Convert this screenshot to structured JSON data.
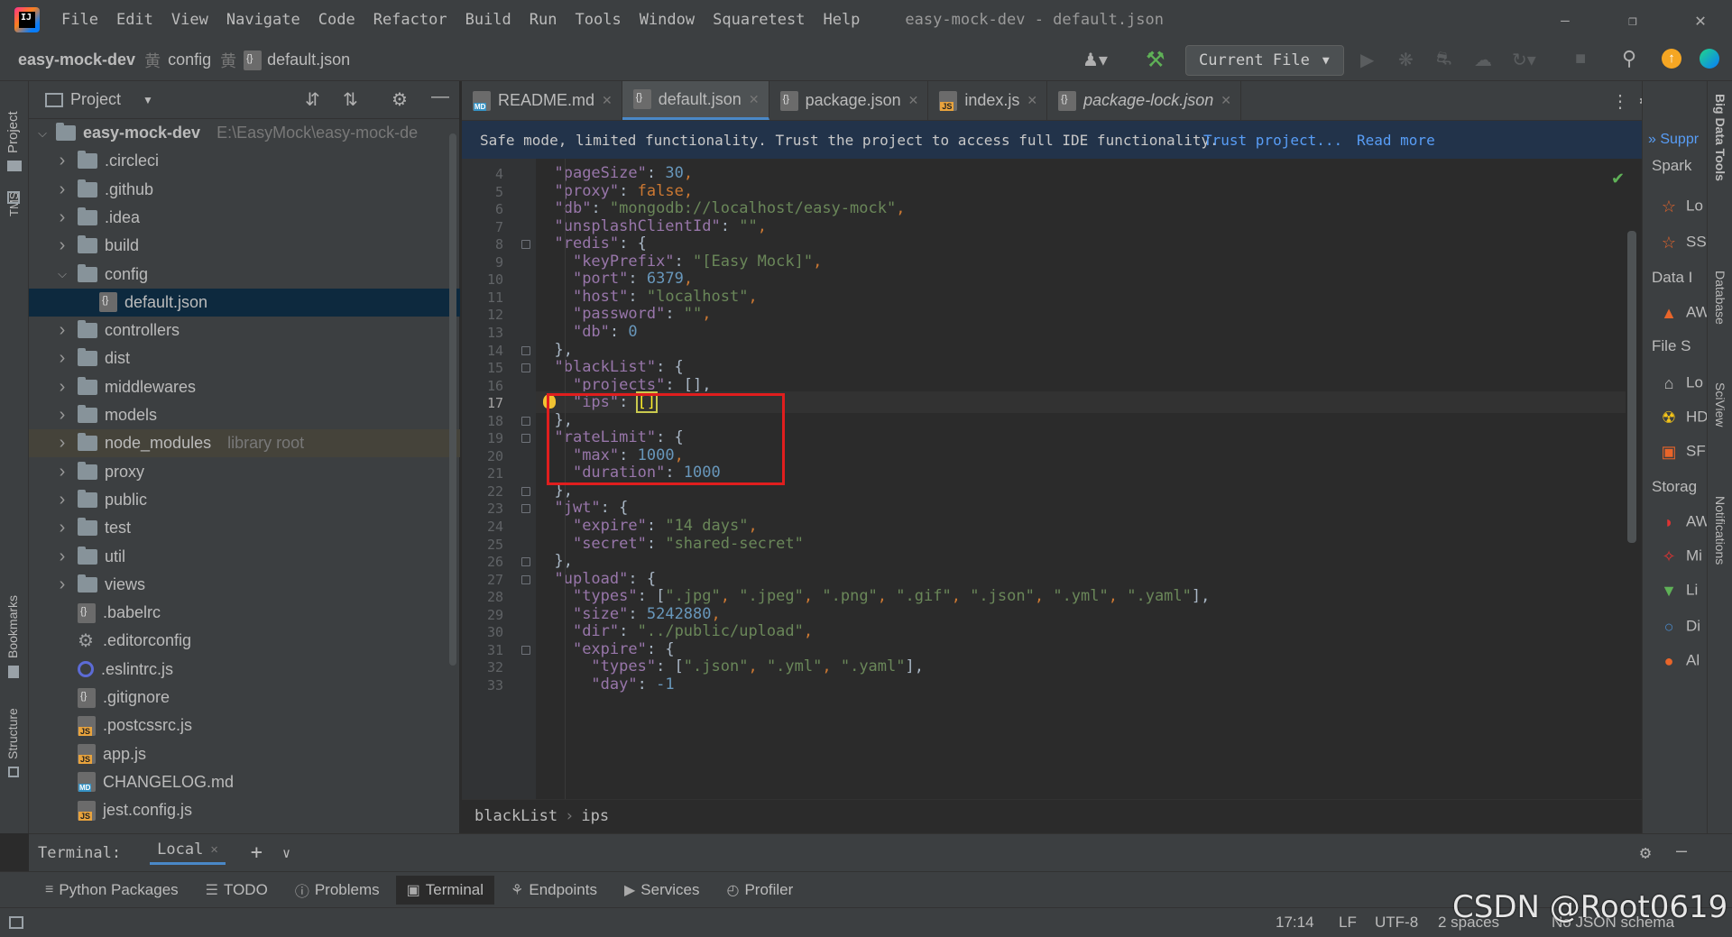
{
  "menubar": {
    "items": [
      "File",
      "Edit",
      "View",
      "Navigate",
      "Code",
      "Refactor",
      "Build",
      "Run",
      "Tools",
      "Window",
      "Squaretest",
      "Help"
    ],
    "window_title": "easy-mock-dev - default.json"
  },
  "navbar": {
    "crumbs": [
      "easy-mock-dev",
      "config",
      "default.json"
    ],
    "run_config": "Current File"
  },
  "left_stripe": {
    "project": "Project",
    "tms": "TMS",
    "bookmarks": "Bookmarks",
    "structure": "Structure"
  },
  "project_panel": {
    "title": "Project",
    "root": {
      "name": "easy-mock-dev",
      "path": "E:\\EasyMock\\easy-mock-de"
    },
    "items": [
      {
        "label": "circleci",
        "display": ".circleci",
        "kind": "folder",
        "expanded": false
      },
      {
        "label": "github",
        "display": ".github",
        "kind": "folder",
        "expanded": false
      },
      {
        "label": "idea",
        "display": ".idea",
        "kind": "folder",
        "expanded": false
      },
      {
        "label": "build",
        "display": "build",
        "kind": "folder",
        "expanded": false
      },
      {
        "label": "config",
        "display": "config",
        "kind": "folder",
        "expanded": true
      },
      {
        "label": "default-json",
        "display": "default.json",
        "kind": "json",
        "selected": true
      },
      {
        "label": "controllers",
        "display": "controllers",
        "kind": "folder"
      },
      {
        "label": "dist",
        "display": "dist",
        "kind": "folder"
      },
      {
        "label": "middlewares",
        "display": "middlewares",
        "kind": "folder"
      },
      {
        "label": "models",
        "display": "models",
        "kind": "folder"
      },
      {
        "label": "node-modules",
        "display": "node_modules",
        "kind": "folder",
        "extra": "library root"
      },
      {
        "label": "proxy",
        "display": "proxy",
        "kind": "folder"
      },
      {
        "label": "public",
        "display": "public",
        "kind": "folder"
      },
      {
        "label": "test",
        "display": "test",
        "kind": "folder"
      },
      {
        "label": "util",
        "display": "util",
        "kind": "folder"
      },
      {
        "label": "views",
        "display": "views",
        "kind": "folder"
      },
      {
        "label": "babelrc",
        "display": ".babelrc",
        "kind": "json"
      },
      {
        "label": "editorconfig",
        "display": ".editorconfig",
        "kind": "gear"
      },
      {
        "label": "eslintrc",
        "display": ".eslintrc.js",
        "kind": "ring"
      },
      {
        "label": "gitignore",
        "display": ".gitignore",
        "kind": "json"
      },
      {
        "label": "postcssrc",
        "display": ".postcssrc.js",
        "kind": "js"
      },
      {
        "label": "app-js",
        "display": "app.js",
        "kind": "js"
      },
      {
        "label": "changelog",
        "display": "CHANGELOG.md",
        "kind": "md"
      },
      {
        "label": "jest-config",
        "display": "jest.config.js",
        "kind": "js"
      }
    ]
  },
  "tabs": [
    {
      "label": "README.md",
      "icon": "md",
      "active": false,
      "italic": false
    },
    {
      "label": "default.json",
      "icon": "json",
      "active": true,
      "italic": false
    },
    {
      "label": "package.json",
      "icon": "json",
      "active": false,
      "italic": false
    },
    {
      "label": "index.js",
      "icon": "js",
      "active": false,
      "italic": false
    },
    {
      "label": "package-lock.json",
      "icon": "json",
      "active": false,
      "italic": true
    }
  ],
  "banner": {
    "message": "Safe mode, limited functionality. Trust the project to access full IDE functionality.",
    "trust_link": "Trust project...",
    "read_more": "Read more"
  },
  "editor": {
    "current_line": 17,
    "lines": [
      {
        "n": 4,
        "tokens": [
          [
            "p",
            "  "
          ],
          [
            "k",
            "\"pageSize\""
          ],
          [
            "p",
            ": "
          ],
          [
            "n",
            "30"
          ],
          [
            "b",
            ","
          ]
        ]
      },
      {
        "n": 5,
        "tokens": [
          [
            "p",
            "  "
          ],
          [
            "k",
            "\"proxy\""
          ],
          [
            "p",
            ": "
          ],
          [
            "b",
            "false"
          ],
          [
            "b",
            ","
          ]
        ]
      },
      {
        "n": 6,
        "tokens": [
          [
            "p",
            "  "
          ],
          [
            "k",
            "\"db\""
          ],
          [
            "p",
            ": "
          ],
          [
            "s",
            "\"mongodb://localhost/easy-mock\""
          ],
          [
            "b",
            ","
          ]
        ]
      },
      {
        "n": 7,
        "tokens": [
          [
            "p",
            "  "
          ],
          [
            "k",
            "\"unsplashClientId\""
          ],
          [
            "p",
            ": "
          ],
          [
            "s",
            "\"\""
          ],
          [
            "b",
            ","
          ]
        ]
      },
      {
        "n": 8,
        "tokens": [
          [
            "p",
            "  "
          ],
          [
            "k",
            "\"redis\""
          ],
          [
            "p",
            ": {"
          ]
        ]
      },
      {
        "n": 9,
        "tokens": [
          [
            "p",
            "    "
          ],
          [
            "k",
            "\"keyPrefix\""
          ],
          [
            "p",
            ": "
          ],
          [
            "s",
            "\"[Easy Mock]\""
          ],
          [
            "b",
            ","
          ]
        ]
      },
      {
        "n": 10,
        "tokens": [
          [
            "p",
            "    "
          ],
          [
            "k",
            "\"port\""
          ],
          [
            "p",
            ": "
          ],
          [
            "n",
            "6379"
          ],
          [
            "b",
            ","
          ]
        ]
      },
      {
        "n": 11,
        "tokens": [
          [
            "p",
            "    "
          ],
          [
            "k",
            "\"host\""
          ],
          [
            "p",
            ": "
          ],
          [
            "s",
            "\"localhost\""
          ],
          [
            "b",
            ","
          ]
        ]
      },
      {
        "n": 12,
        "tokens": [
          [
            "p",
            "    "
          ],
          [
            "k",
            "\"password\""
          ],
          [
            "p",
            ": "
          ],
          [
            "s",
            "\"\""
          ],
          [
            "b",
            ","
          ]
        ]
      },
      {
        "n": 13,
        "tokens": [
          [
            "p",
            "    "
          ],
          [
            "k",
            "\"db\""
          ],
          [
            "p",
            ": "
          ],
          [
            "n",
            "0"
          ]
        ]
      },
      {
        "n": 14,
        "tokens": [
          [
            "p",
            "  },"
          ]
        ]
      },
      {
        "n": 15,
        "tokens": [
          [
            "p",
            "  "
          ],
          [
            "k",
            "\"blackList\""
          ],
          [
            "p",
            ": {"
          ]
        ]
      },
      {
        "n": 16,
        "tokens": [
          [
            "p",
            "    "
          ],
          [
            "k",
            "\"projects\""
          ],
          [
            "p",
            ": [],"
          ]
        ]
      },
      {
        "n": 17,
        "tokens": [
          [
            "p",
            "    "
          ],
          [
            "k",
            "\"ips\""
          ],
          [
            "p",
            ": "
          ],
          [
            "m",
            "[]"
          ]
        ]
      },
      {
        "n": 18,
        "tokens": [
          [
            "p",
            "  },"
          ]
        ]
      },
      {
        "n": 19,
        "tokens": [
          [
            "p",
            "  "
          ],
          [
            "k",
            "\"rateLimit\""
          ],
          [
            "p",
            ": {"
          ]
        ]
      },
      {
        "n": 20,
        "tokens": [
          [
            "p",
            "    "
          ],
          [
            "k",
            "\"max\""
          ],
          [
            "p",
            ": "
          ],
          [
            "n",
            "1000"
          ],
          [
            "b",
            ","
          ]
        ]
      },
      {
        "n": 21,
        "tokens": [
          [
            "p",
            "    "
          ],
          [
            "k",
            "\"duration\""
          ],
          [
            "p",
            ": "
          ],
          [
            "n",
            "1000"
          ]
        ]
      },
      {
        "n": 22,
        "tokens": [
          [
            "p",
            "  },"
          ]
        ]
      },
      {
        "n": 23,
        "tokens": [
          [
            "p",
            "  "
          ],
          [
            "k",
            "\"jwt\""
          ],
          [
            "p",
            ": {"
          ]
        ]
      },
      {
        "n": 24,
        "tokens": [
          [
            "p",
            "    "
          ],
          [
            "k",
            "\"expire\""
          ],
          [
            "p",
            ": "
          ],
          [
            "s",
            "\"14 days\""
          ],
          [
            "b",
            ","
          ]
        ]
      },
      {
        "n": 25,
        "tokens": [
          [
            "p",
            "    "
          ],
          [
            "k",
            "\"secret\""
          ],
          [
            "p",
            ": "
          ],
          [
            "s",
            "\"shared-secret\""
          ]
        ]
      },
      {
        "n": 26,
        "tokens": [
          [
            "p",
            "  },"
          ]
        ]
      },
      {
        "n": 27,
        "tokens": [
          [
            "p",
            "  "
          ],
          [
            "k",
            "\"upload\""
          ],
          [
            "p",
            ": {"
          ]
        ]
      },
      {
        "n": 28,
        "tokens": [
          [
            "p",
            "    "
          ],
          [
            "k",
            "\"types\""
          ],
          [
            "p",
            ": ["
          ],
          [
            "s",
            "\".jpg\""
          ],
          [
            "b",
            ", "
          ],
          [
            "s",
            "\".jpeg\""
          ],
          [
            "b",
            ", "
          ],
          [
            "s",
            "\".png\""
          ],
          [
            "b",
            ", "
          ],
          [
            "s",
            "\".gif\""
          ],
          [
            "b",
            ", "
          ],
          [
            "s",
            "\".json\""
          ],
          [
            "b",
            ", "
          ],
          [
            "s",
            "\".yml\""
          ],
          [
            "b",
            ", "
          ],
          [
            "s",
            "\".yaml\""
          ],
          [
            "p",
            "],"
          ]
        ]
      },
      {
        "n": 29,
        "tokens": [
          [
            "p",
            "    "
          ],
          [
            "k",
            "\"size\""
          ],
          [
            "p",
            ": "
          ],
          [
            "n",
            "5242880"
          ],
          [
            "b",
            ","
          ]
        ]
      },
      {
        "n": 30,
        "tokens": [
          [
            "p",
            "    "
          ],
          [
            "k",
            "\"dir\""
          ],
          [
            "p",
            ": "
          ],
          [
            "s",
            "\"../public/upload\""
          ],
          [
            "b",
            ","
          ]
        ]
      },
      {
        "n": 31,
        "tokens": [
          [
            "p",
            "    "
          ],
          [
            "k",
            "\"expire\""
          ],
          [
            "p",
            ": {"
          ]
        ]
      },
      {
        "n": 32,
        "tokens": [
          [
            "p",
            "      "
          ],
          [
            "k",
            "\"types\""
          ],
          [
            "p",
            ": ["
          ],
          [
            "s",
            "\".json\""
          ],
          [
            "b",
            ", "
          ],
          [
            "s",
            "\".yml\""
          ],
          [
            "b",
            ", "
          ],
          [
            "s",
            "\".yaml\""
          ],
          [
            "p",
            "],"
          ]
        ]
      },
      {
        "n": 33,
        "tokens": [
          [
            "p",
            "      "
          ],
          [
            "k",
            "\"day\""
          ],
          [
            "p",
            ": "
          ],
          [
            "n",
            "-1"
          ]
        ]
      }
    ]
  },
  "editor_breadcrumb": [
    "blackList",
    "ips"
  ],
  "right_panel": {
    "suppress": "» Suppr",
    "items": [
      "Spark",
      "Lo",
      "SS",
      "Data I",
      "AW",
      "File S",
      "Lo",
      "HD",
      "SF",
      "Storag",
      "AW",
      "Mi",
      "Li",
      "Di",
      "Al"
    ]
  },
  "right_stripe": {
    "big_data": "Big Data Tools",
    "database": "Database",
    "sciview": "SciView",
    "notifications": "Notifications"
  },
  "terminal": {
    "label": "Terminal:",
    "tab": "Local"
  },
  "tool_windows": [
    {
      "label": "Python Packages",
      "icon": "layers-icon"
    },
    {
      "label": "TODO",
      "icon": "list-icon"
    },
    {
      "label": "Problems",
      "icon": "info-icon"
    },
    {
      "label": "Terminal",
      "icon": "terminal-icon",
      "active": true
    },
    {
      "label": "Endpoints",
      "icon": "endpoints-icon"
    },
    {
      "label": "Services",
      "icon": "play-icon"
    },
    {
      "label": "Profiler",
      "icon": "profiler-icon"
    }
  ],
  "status": {
    "position": "17:14",
    "line_sep": "LF",
    "encoding": "UTF-8",
    "indent": "2 spaces",
    "schema": "No JSON schema"
  },
  "watermark": "CSDN @Root0619",
  "colors": {
    "accent": "#4a88c7",
    "highlight_box": "#e01e1e",
    "banner_bg": "#22334a",
    "link": "#589df6"
  }
}
